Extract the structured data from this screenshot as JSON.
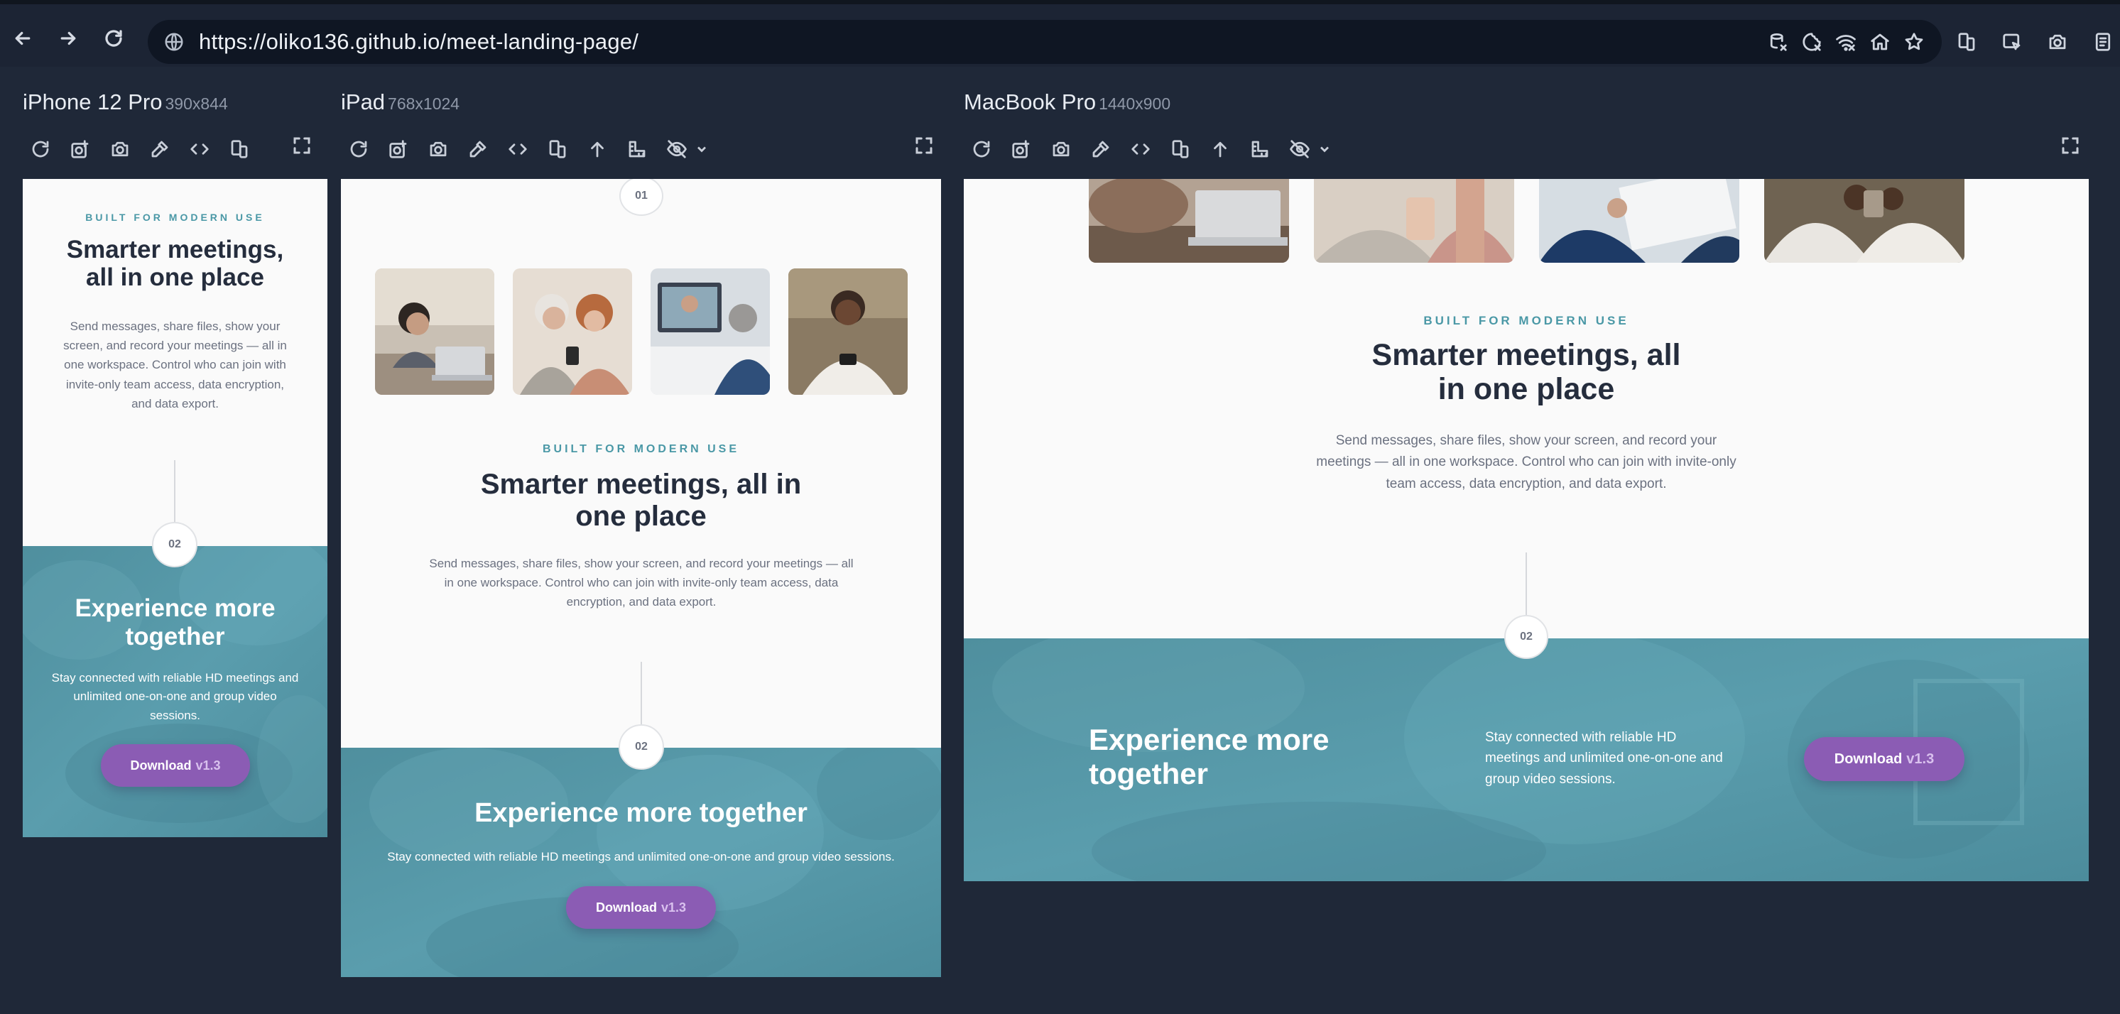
{
  "browser": {
    "url": "https://oliko136.github.io/meet-landing-page/"
  },
  "devices": {
    "iphone": {
      "name": "iPhone 12 Pro",
      "dims": "390x844"
    },
    "ipad": {
      "name": "iPad",
      "dims": "768x1024"
    },
    "macbook": {
      "name": "MacBook Pro",
      "dims": "1440x900"
    }
  },
  "content": {
    "step_one": "01",
    "step_two": "02",
    "eyebrow": "BUILT FOR MODERN USE",
    "heading": "Smarter meetings, all in one place",
    "heading_line1_iphone": "Smarter meetings,",
    "heading_line2_iphone": "all in one place",
    "heading_line1_ipad": "Smarter meetings, all in",
    "heading_line2_ipad": "one place",
    "heading_line1_mac": "Smarter meetings, all",
    "heading_line2_mac": "in one place",
    "body": "Send messages, share files, show your screen, and record your meetings — all in one workspace. Control who can join with invite-only team access, data encryption, and data export.",
    "cta_heading": "Experience more together",
    "cta_heading_line1": "Experience more",
    "cta_heading_line2": "together",
    "cta_body": "Stay connected with reliable HD meetings and unlimited one-on-one and group video sessions.",
    "download_label": "Download",
    "download_version": "v1.3"
  },
  "icons": {
    "nav": [
      "back-arrow-icon",
      "forward-arrow-icon",
      "reload-icon"
    ],
    "url_bar": [
      "globe-icon",
      "database-off-icon",
      "cookie-off-icon",
      "wifi-off-icon",
      "home-icon",
      "star-icon"
    ],
    "toolbar": [
      "refresh-icon",
      "screenshot-icon",
      "camera-icon",
      "color-picker-icon",
      "code-icon",
      "rotate-icon",
      "scroll-up-icon",
      "ruler-icon",
      "hide-icon",
      "expand-icon"
    ]
  },
  "colors": {
    "background": "#1f2838",
    "teal": "#5497a6",
    "eyebrow": "#4a98a6",
    "heading": "#252d3d",
    "button": "#8b5cb4"
  }
}
